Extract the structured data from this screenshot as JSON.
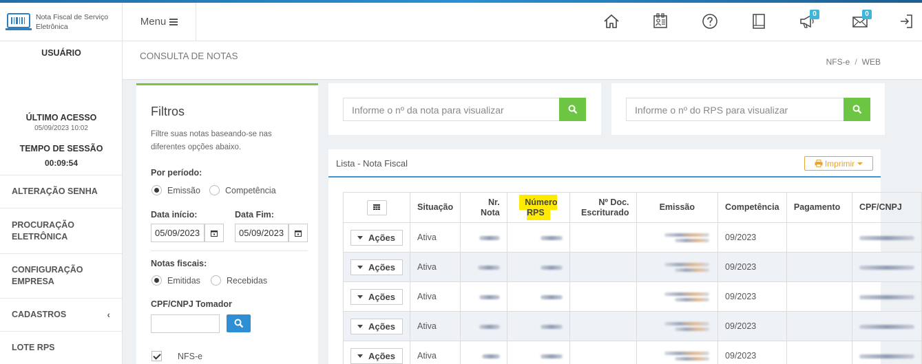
{
  "brand": {
    "name": "Nota Fiscal de Serviço Eletrônica"
  },
  "header": {
    "menu_label": "Menu",
    "icons": [
      "home-icon",
      "contact-card-icon",
      "help-icon",
      "book-icon",
      "megaphone-icon",
      "mail-icon",
      "logout-icon"
    ],
    "notifications_count": "0",
    "messages_count": "0"
  },
  "sidebar": {
    "user_label": "USUÁRIO",
    "last_access_label": "ÚLTIMO ACESSO",
    "last_access_value": "05/09/2023 10:02",
    "session_label": "TEMPO DE SESSÃO",
    "session_value": "00:09:54",
    "items": [
      {
        "label": "ALTERAÇÃO SENHA"
      },
      {
        "label": "PROCURAÇÃO ELETRÔNICA"
      },
      {
        "label": "CONFIGURAÇÃO EMPRESA"
      },
      {
        "label": "CADASTROS",
        "chevron": "‹"
      },
      {
        "label": "LOTE RPS"
      }
    ]
  },
  "page": {
    "title": "CONSULTA DE NOTAS",
    "breadcrumb": [
      "NFS-e",
      "WEB"
    ]
  },
  "filters": {
    "title": "Filtros",
    "description": "Filtre suas notas baseando-se nas diferentes opções abaixo.",
    "period_label": "Por período:",
    "period_options": [
      "Emissão",
      "Competência"
    ],
    "period_selected": "Emissão",
    "start_label": "Data início:",
    "start_value": "05/09/2023",
    "end_label": "Data Fim:",
    "end_value": "05/09/2023",
    "notes_label": "Notas fiscais:",
    "notes_options": [
      "Emitidas",
      "Recebidas"
    ],
    "notes_selected": "Emitidas",
    "cpf_label": "CPF/CNPJ Tomador",
    "cpf_value": "",
    "nfse_check_label": "NFS-e"
  },
  "search": {
    "nota_placeholder": "Informe o nº da nota para visualizar",
    "rps_placeholder": "Informe o nº do RPS para visualizar"
  },
  "list": {
    "title": "Lista - Nota Fiscal",
    "print_label": "Imprimir",
    "columns": [
      "",
      "Situação",
      "Nr. Nota",
      "Número RPS",
      "Nº Doc. Escriturado",
      "Emissão",
      "Competência",
      "Pagamento",
      "CPF/CNPJ"
    ],
    "action_label": "Ações",
    "rows": [
      {
        "situacao": "Ativa",
        "competencia": "09/2023"
      },
      {
        "situacao": "Ativa",
        "competencia": "09/2023"
      },
      {
        "situacao": "Ativa",
        "competencia": "09/2023"
      },
      {
        "situacao": "Ativa",
        "competencia": "09/2023"
      },
      {
        "situacao": "Ativa",
        "competencia": "09/2023"
      }
    ]
  },
  "colors": {
    "accent_green": "#6cc644",
    "accent_blue": "#2e8fd4",
    "highlight_yellow": "#ffea00",
    "print_orange": "#e7a531"
  }
}
